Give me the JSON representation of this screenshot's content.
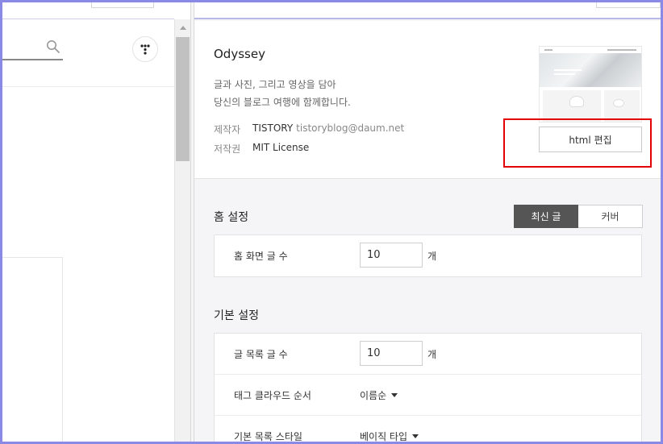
{
  "theme": {
    "name": "Odyssey",
    "description_line1": "글과 사진, 그리고 영상을 담아",
    "description_line2": "당신의 블로그 여행에 함께합니다.",
    "author_label": "제작자",
    "author_name": "TISTORY",
    "author_email": "tistoryblog@daum.net",
    "license_label": "저작권",
    "license_value": "MIT License",
    "html_edit_label": "html 편집"
  },
  "home_settings": {
    "title": "홈 설정",
    "toggle": [
      {
        "label": "최신 글",
        "selected": true
      },
      {
        "label": "커버",
        "selected": false
      }
    ],
    "rows": [
      {
        "label": "홈 화면 글 수",
        "value": "10",
        "unit": "개"
      }
    ]
  },
  "basic_settings": {
    "title": "기본 설정",
    "post_count": {
      "label": "글 목록 글 수",
      "value": "10",
      "unit": "개"
    },
    "tag_order": {
      "label": "태그 클라우드 순서",
      "value": "이름순"
    },
    "list_style": {
      "label": "기본 목록 스타일",
      "value": "베이직 타입"
    }
  },
  "icons": {
    "search": "search-icon",
    "menu": "dots-menu-icon",
    "dropdown": "caret-down-icon"
  },
  "colors": {
    "accent_frame": "#8a8ae6",
    "highlight": "#e30000",
    "toggle_active": "#555555"
  }
}
